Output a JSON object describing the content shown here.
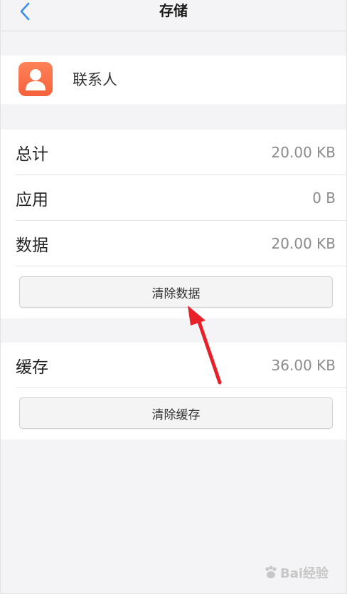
{
  "header": {
    "title": "存储",
    "back_icon": "chevron-left-icon",
    "accent_color": "#3b8ff0"
  },
  "app": {
    "name": "联系人",
    "icon": "contacts-person-icon",
    "icon_color": "#f66a44"
  },
  "storage": {
    "rows": [
      {
        "label": "总计",
        "value": "20.00 KB"
      },
      {
        "label": "应用",
        "value": "0 B"
      },
      {
        "label": "数据",
        "value": "20.00 KB"
      }
    ],
    "clear_button": "清除数据"
  },
  "cache": {
    "label": "缓存",
    "value": "36.00 KB",
    "clear_button": "清除缓存"
  },
  "annotation": {
    "arrow_color": "#e8202a"
  },
  "watermark": {
    "text": "Bai经验",
    "icon": "baidu-paw-icon"
  }
}
